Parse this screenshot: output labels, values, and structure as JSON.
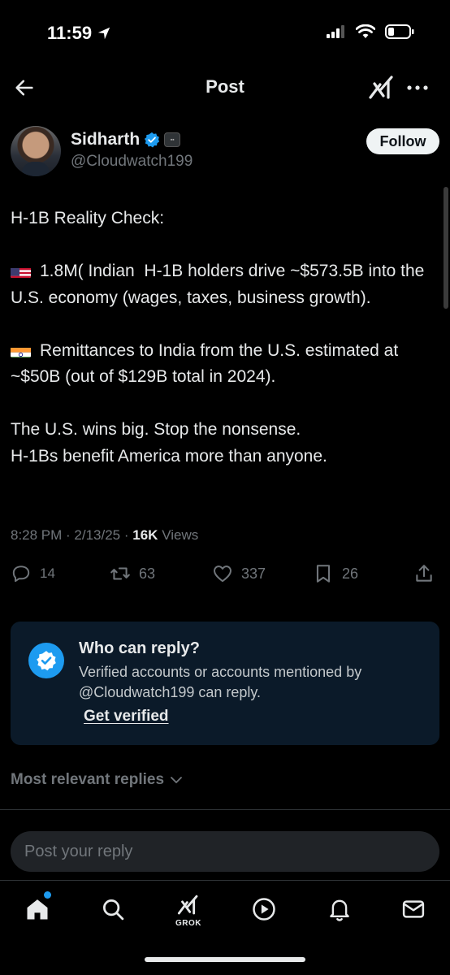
{
  "status_bar": {
    "time": "11:59"
  },
  "header": {
    "title": "Post"
  },
  "author": {
    "name": "Sidharth",
    "handle": "@Cloudwatch199",
    "follow_label": "Follow"
  },
  "post": {
    "title_line": "H-1B Reality Check:",
    "para1": "1.8M( Indian  H-1B holders drive ~$573.5B into the U.S. economy (wages, taxes, business growth).",
    "para2": "Remittances to India from the U.S. estimated at ~$50B (out of $129B total in 2024).",
    "para3_line1": "The U.S. wins big. Stop the nonsense.",
    "para3_line2": "H-1Bs benefit America more than anyone."
  },
  "meta": {
    "time": "8:28 PM",
    "date": "2/13/25",
    "views_count": "16K",
    "views_label": "Views"
  },
  "actions": {
    "replies": "14",
    "reposts": "63",
    "likes": "337",
    "bookmarks": "26"
  },
  "reply_card": {
    "title": "Who can reply?",
    "text": "Verified accounts or accounts mentioned by @Cloudwatch199 can reply.",
    "cta": "Get verified"
  },
  "sort": {
    "label": "Most relevant replies"
  },
  "composer": {
    "placeholder": "Post your reply"
  },
  "tabbar": {
    "grok_label": "GROK"
  },
  "colors": {
    "accent": "#1d9bf0",
    "background": "#000000",
    "card": "#0b1a29"
  }
}
